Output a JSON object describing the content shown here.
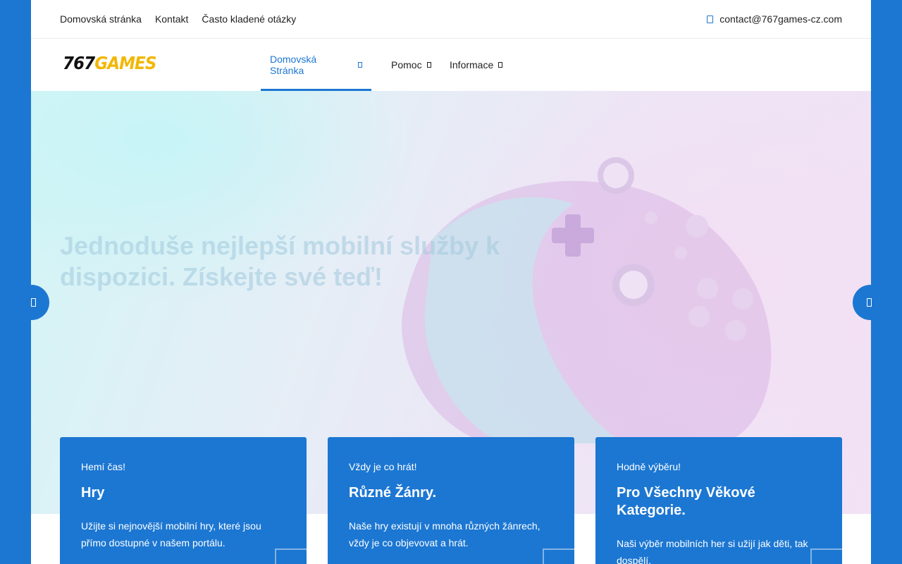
{
  "topbar": {
    "links": [
      "Domovská stránka",
      "Kontakt",
      "Často kladené otázky"
    ],
    "email": "contact@767games-cz.com"
  },
  "logo": {
    "number": "767",
    "word": "GAMES"
  },
  "nav": [
    {
      "label": "Domovská Stránka",
      "active": true
    },
    {
      "label": "Pomoc",
      "active": false
    },
    {
      "label": "Informace",
      "active": false
    }
  ],
  "hero": {
    "title": "Jednoduše nejlepší mobilní služby k dispozici. Získejte své teď!"
  },
  "cards": [
    {
      "kicker": "Hemí čas!",
      "title": "Hry",
      "text": "Užijte si nejnovější mobilní hry, které jsou přímo dostupné v našem portálu."
    },
    {
      "kicker": "Vždy je co hrát!",
      "title": "Různé Žánry.",
      "text": "Naše hry existují v mnoha různých žánrech, vždy je co objevovat a hrát."
    },
    {
      "kicker": "Hodně výběru!",
      "title": "Pro Všechny Věkové Kategorie.",
      "text": "Naši výběr mobilních her si užijí jak děti, tak dospělí."
    }
  ],
  "colors": {
    "accent": "#1c77d2",
    "logo_yellow": "#f2b705"
  }
}
